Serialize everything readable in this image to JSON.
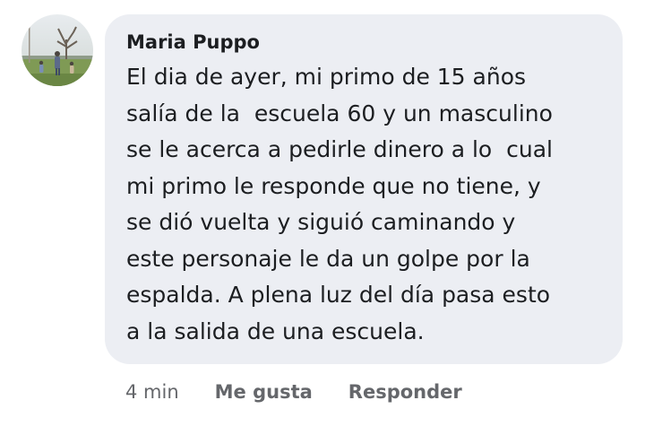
{
  "comment": {
    "author": "Maria Puppo",
    "lines": [
      "El dia de ayer, mi primo de 15 años",
      "salía de la  escuela 60 y un masculino",
      "se le acerca a pedirle dinero a lo  cual",
      "mi primo le responde que no tiene, y",
      "se dió vuelta y siguió caminando y",
      "este personaje le da un golpe por la",
      "espalda. A plena luz del día pasa esto",
      "a la salida de una escuela."
    ],
    "timestamp": "4 min",
    "like_label": "Me gusta",
    "reply_label": "Responder"
  },
  "colors": {
    "bubble_background": "#eceef3",
    "text_primary": "#1c1e21",
    "text_secondary": "#65676b"
  },
  "icons": {
    "avatar": "profile-photo"
  }
}
